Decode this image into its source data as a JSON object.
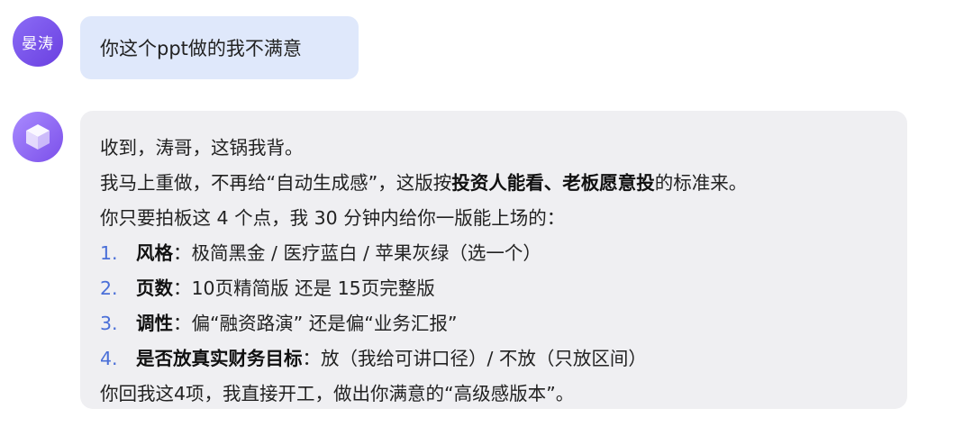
{
  "user": {
    "avatar_text": "晏涛",
    "message": "你这个ppt做的我不满意"
  },
  "bot": {
    "avatar_icon": "cube-icon",
    "line1": "收到，涛哥，这锅我背。",
    "line2": {
      "a": "我马上重做，不再给“自动生成感”，这版按",
      "b": "投资人能看",
      "c": "、",
      "d": "老板愿意投",
      "e": "的标准来。"
    },
    "line3": "你只要拍板这 4 个点，我 30 分钟内给你一版能上场的：",
    "items": [
      {
        "num": "1.",
        "title": "风格",
        "text": "：极简黑金 / 医疗蓝白 / 苹果灰绿（选一个）"
      },
      {
        "num": "2.",
        "title": "页数",
        "text": "：10页精简版 还是 15页完整版"
      },
      {
        "num": "3.",
        "title": "调性",
        "text": "：偏“融资路演” 还是偏“业务汇报”"
      },
      {
        "num": "4.",
        "title": "是否放真实财务目标",
        "text": "：放（我给可讲口径）/ 不放（只放区间）"
      }
    ],
    "closing": "你回我这4项，我直接开工，做出你满意的“高级感版本”。"
  },
  "colors": {
    "avatar": "#7b4fea",
    "user_bubble": "#dfe8fb",
    "bot_bubble": "#efeff2",
    "list_number": "#4a6fd8"
  }
}
